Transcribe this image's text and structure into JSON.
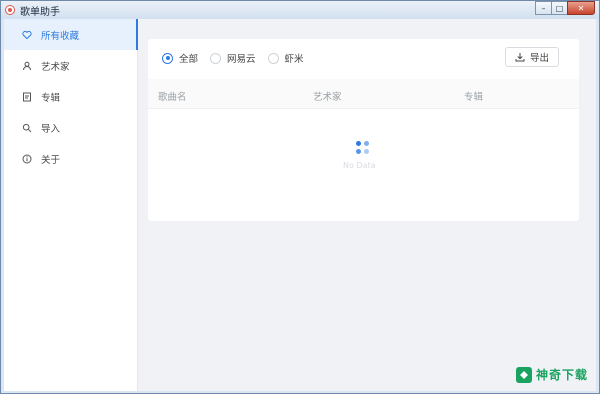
{
  "window": {
    "title": "歌单助手",
    "minimize_glyph": "–",
    "maximize_glyph": "□",
    "close_glyph": "✕"
  },
  "sidebar": {
    "items": [
      {
        "label": "所有收藏",
        "icon": "heart-icon",
        "active": true
      },
      {
        "label": "艺术家",
        "icon": "user-icon",
        "active": false
      },
      {
        "label": "专辑",
        "icon": "album-icon",
        "active": false
      },
      {
        "label": "导入",
        "icon": "search-icon",
        "active": false
      },
      {
        "label": "关于",
        "icon": "info-icon",
        "active": false
      }
    ]
  },
  "filter": {
    "options": [
      {
        "label": "全部",
        "checked": true
      },
      {
        "label": "网易云",
        "checked": false
      },
      {
        "label": "虾米",
        "checked": false
      }
    ]
  },
  "toolbar": {
    "export_label": "导出"
  },
  "table": {
    "columns": [
      "歌曲名",
      "艺术家",
      "专辑"
    ]
  },
  "loading": {
    "text": "No Data"
  },
  "watermark": {
    "text": "神奇下载"
  },
  "colors": {
    "accent": "#2d7ae0",
    "watermark": "#1aa260"
  }
}
